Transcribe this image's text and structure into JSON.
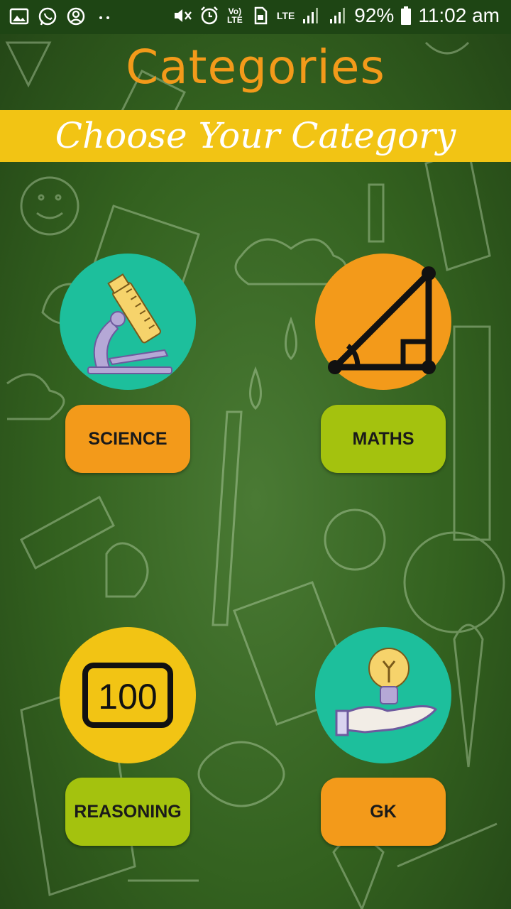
{
  "status_bar": {
    "battery": "92%",
    "time": "11:02 am",
    "network": "LTE",
    "volte": "Vo) LTE"
  },
  "header": {
    "title": "Categories",
    "subtitle": "Choose Your Category"
  },
  "categories": [
    {
      "label": "SCIENCE",
      "icon": "microscope-icon"
    },
    {
      "label": "MATHS",
      "icon": "triangle-geometry-icon"
    },
    {
      "label": "REASONING",
      "icon": "number-100-icon"
    },
    {
      "label": "GK",
      "icon": "lightbulb-hand-icon"
    }
  ],
  "colors": {
    "title_orange": "#f39a1a",
    "banner_yellow": "#f2c414",
    "teal": "#1dbf9c",
    "orange": "#f39a1a",
    "lime": "#a4c20e",
    "yellow": "#f2c414",
    "board_green": "#33611f"
  }
}
